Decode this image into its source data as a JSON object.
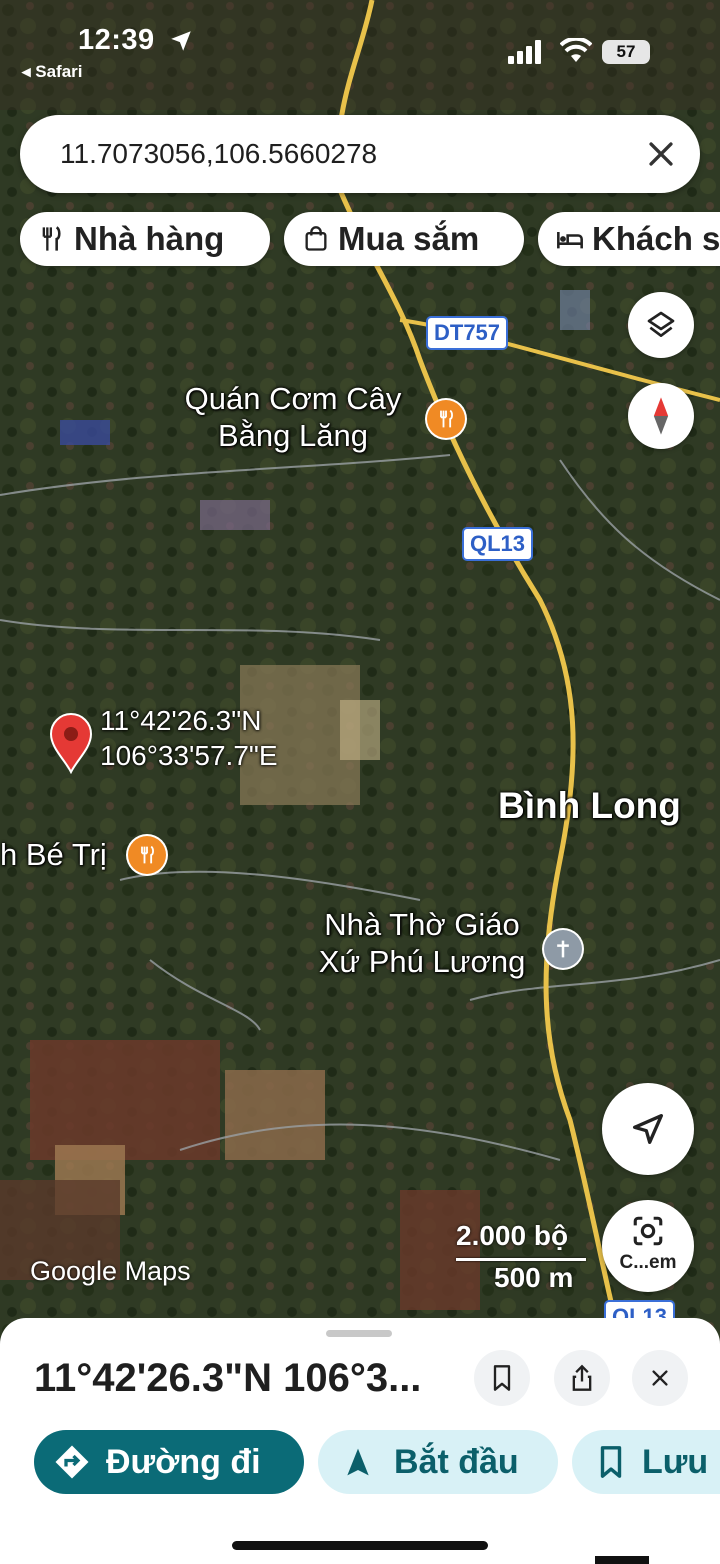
{
  "status_bar": {
    "time": "12:39",
    "back_app": "◂ Safari",
    "battery": "57"
  },
  "search": {
    "value": "11.7073056,106.5660278",
    "clear_icon": "close-icon"
  },
  "chips": [
    {
      "label": "Nhà hàng",
      "icon": "restaurant-icon"
    },
    {
      "label": "Mua sắm",
      "icon": "shopping-bag-icon"
    },
    {
      "label": "Khách sạn",
      "icon": "bed-icon"
    }
  ],
  "map": {
    "road_shields": [
      "DT757",
      "QL13",
      "QL13"
    ],
    "places": [
      {
        "name": "Quán Cơm Cây",
        "name2": "Bằng Lăng",
        "type": "restaurant"
      },
      {
        "name": "Bình Long",
        "type": "city"
      },
      {
        "name": "h Bé Trị",
        "type": "restaurant"
      },
      {
        "name": "Nhà Thờ Giáo",
        "name2": "Xứ Phú Lương",
        "type": "church"
      }
    ],
    "pin": {
      "lat_dms": "11°42'26.3\"N",
      "lng_dms": "106°33'57.7\"E"
    },
    "attribution": "Google Maps",
    "scale": {
      "imperial": "2.000 bộ",
      "metric": "500 m"
    },
    "camera_label": "C...em"
  },
  "sheet": {
    "title": "11°42'26.3\"N 106°3...",
    "actions": {
      "directions": "Đường đi",
      "start": "Bắt đầu",
      "save": "Lưu"
    }
  },
  "colors": {
    "directions_bg": "#0b6b77",
    "secondary_bg": "#d8f1f6",
    "pin": "#e53935",
    "road_major": "#e8c14a"
  }
}
